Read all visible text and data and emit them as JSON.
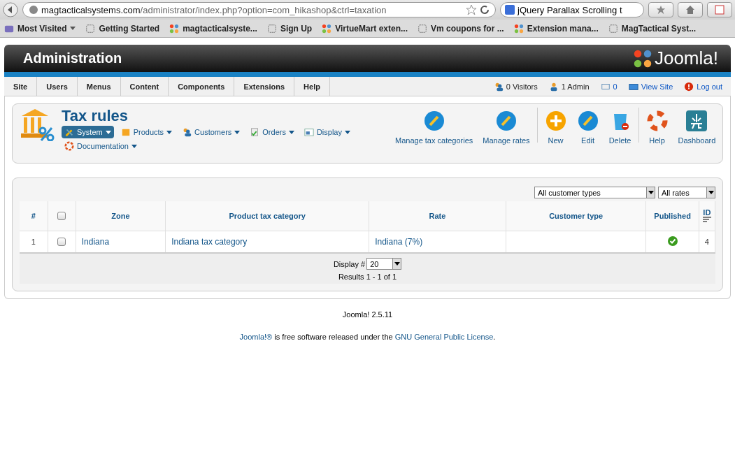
{
  "browser": {
    "url_host": "magtacticalsystems.com",
    "url_path": "/administrator/index.php?option=com_hikashop&ctrl=taxation",
    "search_value": "jQuery Parallax Scrolling t",
    "bookmarks": [
      {
        "label": "Most Visited",
        "kind": "folder"
      },
      {
        "label": "Getting Started",
        "kind": "page"
      },
      {
        "label": "magtacticalsyste...",
        "kind": "joomla"
      },
      {
        "label": "Sign Up",
        "kind": "page"
      },
      {
        "label": "VirtueMart exten...",
        "kind": "joomla"
      },
      {
        "label": "Vm coupons for ...",
        "kind": "page"
      },
      {
        "label": "Extension mana...",
        "kind": "joomla"
      },
      {
        "label": "MagTactical Syst...",
        "kind": "page"
      }
    ]
  },
  "header": {
    "title": "Administration",
    "logo_text": "Joomla!"
  },
  "menu": {
    "items": [
      "Site",
      "Users",
      "Menus",
      "Content",
      "Components",
      "Extensions",
      "Help"
    ],
    "status": [
      {
        "label": "0 Visitors",
        "kind": "users"
      },
      {
        "label": "1 Admin",
        "kind": "user"
      },
      {
        "label": "0",
        "kind": "messages"
      },
      {
        "label": "View Site",
        "kind": "site"
      },
      {
        "label": "Log out",
        "kind": "logout"
      }
    ]
  },
  "page": {
    "title": "Tax rules",
    "submenu": [
      {
        "label": "System",
        "kind": "tools",
        "selected": true
      },
      {
        "label": "Products",
        "kind": "box",
        "selected": false
      },
      {
        "label": "Customers",
        "kind": "users",
        "selected": false
      },
      {
        "label": "Orders",
        "kind": "doc",
        "selected": false
      },
      {
        "label": "Display",
        "kind": "window",
        "selected": false
      },
      {
        "label": "Documentation",
        "kind": "help",
        "selected": false
      }
    ],
    "toolbar": [
      {
        "label": "Manage tax categories",
        "kind": "pencil",
        "divider_before": false
      },
      {
        "label": "Manage rates",
        "kind": "pencil",
        "divider_before": false
      },
      {
        "label": "New",
        "kind": "plus",
        "divider_before": true
      },
      {
        "label": "Edit",
        "kind": "pencil",
        "divider_before": false
      },
      {
        "label": "Delete",
        "kind": "trash",
        "divider_before": false
      },
      {
        "label": "Help",
        "kind": "lifebuoy",
        "divider_before": true
      },
      {
        "label": "Dashboard",
        "kind": "dashboard",
        "divider_before": false
      }
    ]
  },
  "filters": {
    "customer_type": "All customer types",
    "rates": "All rates"
  },
  "table": {
    "columns": [
      "#",
      "",
      "Zone",
      "Product tax category",
      "Rate",
      "Customer type",
      "Published",
      "ID"
    ],
    "rows": [
      {
        "num": "1",
        "checked": false,
        "zone": "Indiana",
        "category": "Indiana tax category",
        "rate": "Indiana (7%)",
        "customer_type": "",
        "published": true,
        "id": "4"
      }
    ],
    "header_checked": false
  },
  "pagination": {
    "display_label": "Display #",
    "display_value": "20",
    "results": "Results 1 - 1 of 1"
  },
  "footer": {
    "version": "Joomla! 2.5.11",
    "license_link": "Joomla!®",
    "license_text": " is free software released under the ",
    "gpl_link": "GNU General Public License",
    "end": "."
  }
}
